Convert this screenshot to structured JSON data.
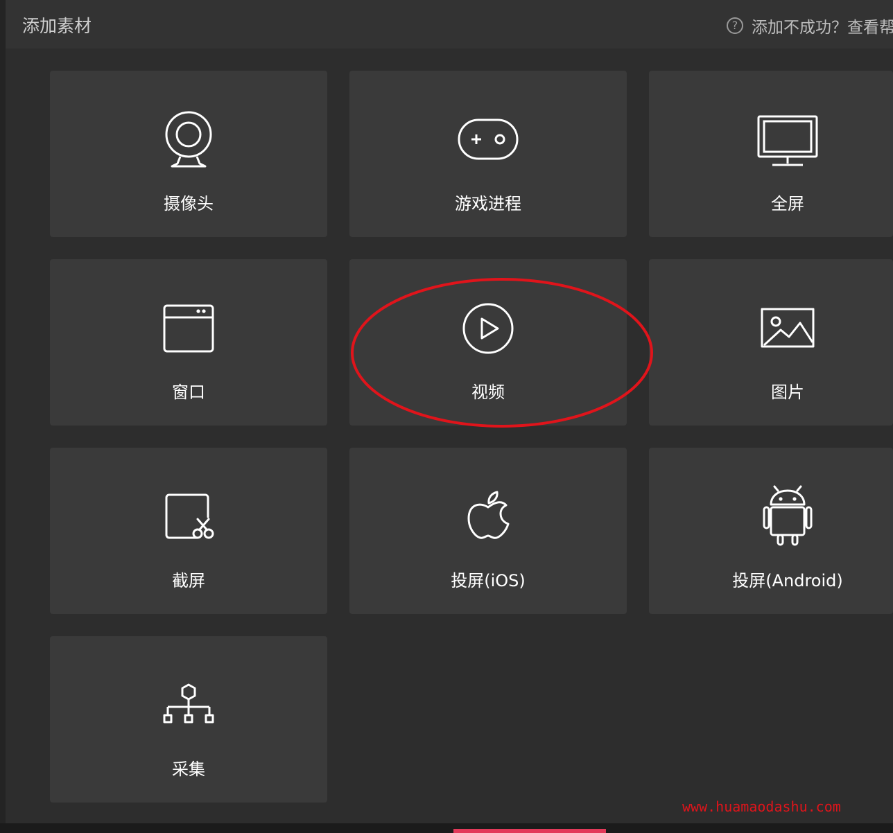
{
  "dialog": {
    "title": "添加素材",
    "help_text": "添加不成功？查看帮助"
  },
  "tiles": [
    {
      "label": "摄像头",
      "icon": "webcam-icon"
    },
    {
      "label": "游戏进程",
      "icon": "gamepad-icon"
    },
    {
      "label": "全屏",
      "icon": "monitor-icon"
    },
    {
      "label": "窗口",
      "icon": "window-icon"
    },
    {
      "label": "视频",
      "icon": "play-icon"
    },
    {
      "label": "图片",
      "icon": "image-icon"
    },
    {
      "label": "截屏",
      "icon": "screenshot-icon"
    },
    {
      "label": "投屏(iOS)",
      "icon": "apple-icon"
    },
    {
      "label": "投屏(Android)",
      "icon": "android-icon"
    },
    {
      "label": "采集",
      "icon": "network-icon"
    }
  ],
  "annotation": {
    "color": "#e0141b",
    "target": "视频"
  },
  "watermark": "www.huamaodashu.com",
  "colors": {
    "background": "#2d2d2d",
    "tile": "#3a3a3a",
    "header": "#333333",
    "text": "#ffffff"
  }
}
